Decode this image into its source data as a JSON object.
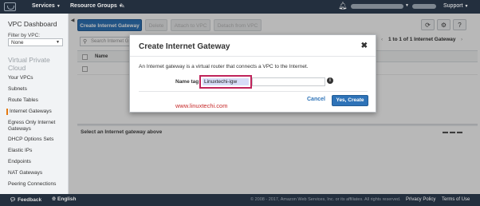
{
  "topbar": {
    "services": "Services",
    "resource_groups": "Resource Groups",
    "support": "Support"
  },
  "sidebar": {
    "title": "VPC Dashboard",
    "filter_label": "Filter by VPC:",
    "filter_value": "None",
    "section": "Virtual Private Cloud",
    "items": [
      "Your VPCs",
      "Subnets",
      "Route Tables",
      "Internet Gateways",
      "Egress Only Internet Gateways",
      "DHCP Options Sets",
      "Elastic IPs",
      "Endpoints",
      "NAT Gateways",
      "Peering Connections"
    ],
    "active_item": "Internet Gateways"
  },
  "toolbar": {
    "create_button": "Create Internet Gateway",
    "delete_button": "Delete",
    "attach_button": "Attach to VPC",
    "detach_button": "Detach from VPC"
  },
  "list": {
    "search_placeholder": "Search Internet G",
    "pager_text": "1 to 1 of 1 Internet Gateway",
    "column_name": "Name"
  },
  "details": {
    "empty_text": "Select an Internet gateway above"
  },
  "modal": {
    "title": "Create Internet Gateway",
    "description": "An Internet gateway is a virtual router that connects a VPC to the Internet.",
    "name_tag_label": "Name tag",
    "name_tag_value": "Linuxtechi-igw",
    "watermark": "www.linuxtechi.com",
    "cancel": "Cancel",
    "submit": "Yes, Create"
  },
  "footer": {
    "feedback": "Feedback",
    "language": "English",
    "copyright": "© 2008 - 2017, Amazon Web Services, Inc. or its affiliates. All rights reserved.",
    "privacy": "Privacy Policy",
    "terms": "Terms of Use"
  },
  "colors": {
    "topbar_bg": "#232f3e",
    "primary_button": "#2e73b8",
    "active_accent": "#e47911",
    "highlight_border": "#c0245b"
  }
}
